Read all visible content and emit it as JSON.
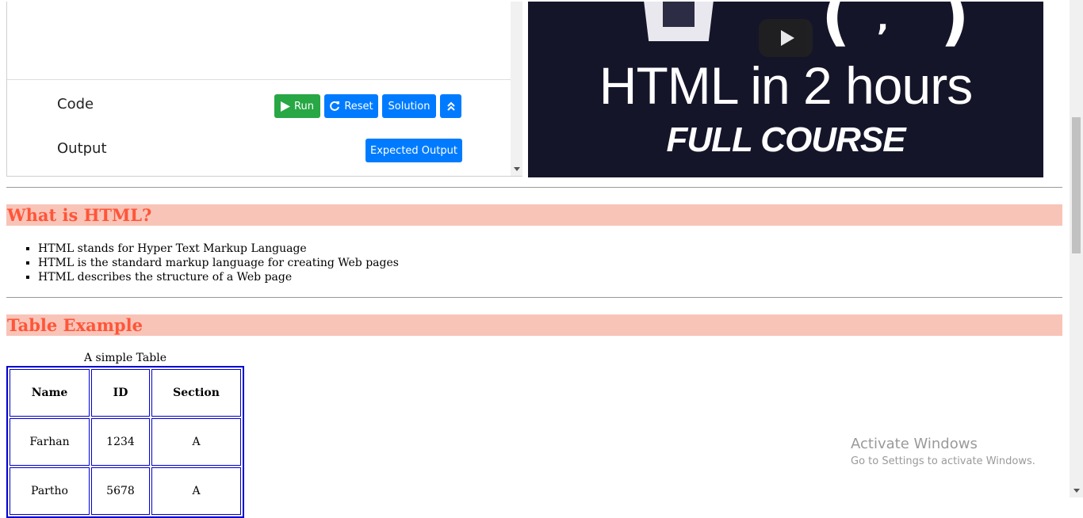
{
  "code_panel": {
    "code_label": "Code",
    "output_label": "Output",
    "buttons": {
      "run": "Run",
      "reset": "Reset",
      "solution": "Solution",
      "expected_output": "Expected Output"
    }
  },
  "video": {
    "title": "HTML in 2 hours",
    "subtitle": "FULL COURSE"
  },
  "sections": {
    "what_is_html": {
      "heading": "What is HTML?",
      "items": [
        "HTML stands for Hyper Text Markup Language",
        "HTML is the standard markup language for creating Web pages",
        "HTML describes the structure of a Web page"
      ]
    },
    "table_example": {
      "heading": "Table Example",
      "caption": "A simple Table",
      "headers": [
        "Name",
        "ID",
        "Section"
      ],
      "rows": [
        [
          "Farhan",
          "1234",
          "A"
        ],
        [
          "Partho",
          "5678",
          "A"
        ]
      ]
    }
  },
  "watermark": {
    "title": "Activate Windows",
    "subtitle": "Go to Settings to activate Windows."
  },
  "colors": {
    "heading_bg": "#f8c4b8",
    "heading_text": "#ff5539",
    "run_button": "#28a745",
    "primary_button": "#007bff",
    "table_border": "#0000cc",
    "video_bg": "#15152a"
  }
}
